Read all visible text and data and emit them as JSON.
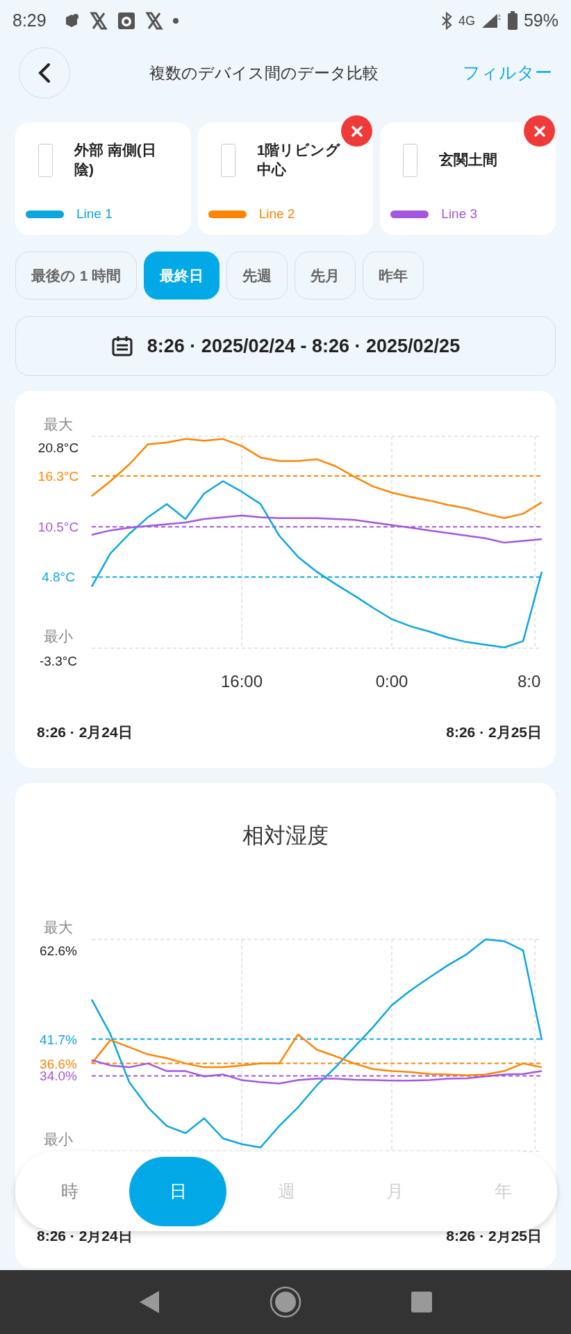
{
  "status_bar": {
    "time": "8:29",
    "network": "4G",
    "battery": "59%"
  },
  "header": {
    "title": "複数のデバイス間のデータ比較",
    "action": "フィルター"
  },
  "devices": [
    {
      "name": "外部 南側(日陰)",
      "line_label": "Line 1",
      "color": "#0aa6e2",
      "removable": false
    },
    {
      "name": "1階リビング中心",
      "line_label": "Line 2",
      "color": "#ff8400",
      "removable": true
    },
    {
      "name": "玄関土間",
      "line_label": "Line 3",
      "color": "#a356e0",
      "removable": true
    }
  ],
  "ranges": [
    {
      "label": "最後の 1 時間",
      "selected": false
    },
    {
      "label": "最終日",
      "selected": true
    },
    {
      "label": "先週",
      "selected": false
    },
    {
      "label": "先月",
      "selected": false
    },
    {
      "label": "昨年",
      "selected": false
    }
  ],
  "date_range": "8:26 · 2025/02/24 - 8:26 · 2025/02/25",
  "charts": [
    {
      "max_label": "最大",
      "min_label": "最小",
      "start_label": "8:26 · 2月24日",
      "end_label": "8:26 · 2月25日",
      "chart_data": {
        "type": "line",
        "categories": [
          null,
          null,
          null,
          null,
          null,
          null,
          null,
          null,
          "16:00",
          null,
          null,
          null,
          null,
          null,
          null,
          null,
          "0:00",
          null,
          null,
          null,
          null,
          null,
          null,
          null,
          "8:0"
        ],
        "ylim": [
          -3.3,
          20.8
        ],
        "yticks": [
          {
            "value": 20.8,
            "label": "20.8°C"
          },
          {
            "value": -3.3,
            "label": "-3.3°C"
          }
        ],
        "series": [
          {
            "color": "#0aa6e2",
            "values": [
              3.7,
              7.5,
              9.7,
              11.6,
              13.1,
              11.4,
              14.3,
              15.7,
              14.5,
              13.1,
              9.5,
              7.1,
              5.4,
              4.0,
              2.7,
              1.3,
              0.0,
              -0.8,
              -1.4,
              -2.1,
              -2.6,
              -2.9,
              -3.2,
              -2.5,
              5.4
            ]
          },
          {
            "color": "#ff8400",
            "values": [
              14.0,
              15.7,
              17.6,
              19.9,
              20.1,
              20.5,
              20.3,
              20.5,
              19.7,
              18.4,
              18.0,
              18.0,
              18.2,
              17.4,
              16.2,
              15.1,
              14.4,
              13.9,
              13.5,
              13.0,
              12.6,
              12.0,
              11.5,
              12.0,
              13.3
            ]
          },
          {
            "color": "#a356e0",
            "values": [
              9.6,
              10.1,
              10.4,
              10.6,
              10.8,
              11.0,
              11.4,
              11.6,
              11.8,
              11.6,
              11.5,
              11.5,
              11.5,
              11.4,
              11.3,
              11.0,
              10.7,
              10.4,
              10.1,
              9.8,
              9.5,
              9.2,
              8.7,
              8.9,
              9.1
            ]
          }
        ],
        "ref_lines": [
          {
            "axis": "y",
            "value": 16.3,
            "label": "16.3°C",
            "color": "#ff8400"
          },
          {
            "axis": "y",
            "value": 10.5,
            "label": "10.5°C",
            "color": "#a356e0"
          },
          {
            "axis": "y",
            "value": 4.8,
            "label": "4.8°C",
            "color": "#0aa6e2"
          }
        ]
      }
    },
    {
      "title": "相対湿度",
      "max_label": "最大",
      "min_label": "最小",
      "start_label": "8:26 · 2月24日",
      "end_label": "8:26 · 2月25日",
      "chart_data": {
        "type": "line",
        "ylim": [
          18.2,
          62.6
        ],
        "yticks": [
          {
            "value": 62.6,
            "label": "62.6%"
          },
          {
            "value": 41.7,
            "label": "41.7%"
          },
          {
            "value": 36.6,
            "label": "36.6%"
          },
          {
            "value": 34.0,
            "label": "34.0%"
          }
        ],
        "series": [
          {
            "color": "#0aa6e2",
            "values": [
              50.0,
              42.7,
              32.7,
              27.4,
              23.5,
              22.0,
              25.1,
              20.9,
              19.7,
              19.0,
              23.5,
              27.4,
              32.0,
              35.8,
              40.0,
              44.2,
              48.8,
              51.9,
              54.6,
              57.2,
              59.5,
              62.6,
              62.2,
              60.3,
              41.5
            ]
          },
          {
            "color": "#ff8400",
            "values": [
              36.6,
              41.5,
              40.0,
              38.5,
              37.7,
              36.6,
              35.8,
              35.8,
              36.2,
              36.6,
              36.6,
              42.7,
              39.5,
              38.1,
              36.6,
              35.4,
              35.0,
              34.8,
              34.4,
              34.3,
              34.1,
              34.3,
              35.0,
              36.6,
              35.8
            ]
          },
          {
            "color": "#a356e0",
            "values": [
              37.3,
              36.2,
              35.8,
              36.6,
              35.0,
              35.0,
              33.9,
              34.3,
              33.1,
              32.7,
              32.4,
              33.1,
              33.4,
              33.4,
              33.2,
              33.1,
              33.0,
              33.0,
              33.1,
              33.4,
              33.5,
              33.9,
              34.3,
              34.4,
              35.0
            ]
          }
        ],
        "ref_lines": [
          {
            "axis": "y",
            "value": 41.7,
            "color": "#0aa6e2"
          },
          {
            "axis": "y",
            "value": 36.6,
            "color": "#ff8400"
          },
          {
            "axis": "y",
            "value": 34.0,
            "color": "#a356e0"
          }
        ]
      }
    }
  ],
  "period_tabs": [
    {
      "label": "時",
      "selected": false,
      "disabled": false
    },
    {
      "label": "日",
      "selected": true,
      "disabled": false
    },
    {
      "label": "週",
      "selected": false,
      "disabled": true
    },
    {
      "label": "月",
      "selected": false,
      "disabled": true
    },
    {
      "label": "年",
      "selected": false,
      "disabled": true
    }
  ]
}
